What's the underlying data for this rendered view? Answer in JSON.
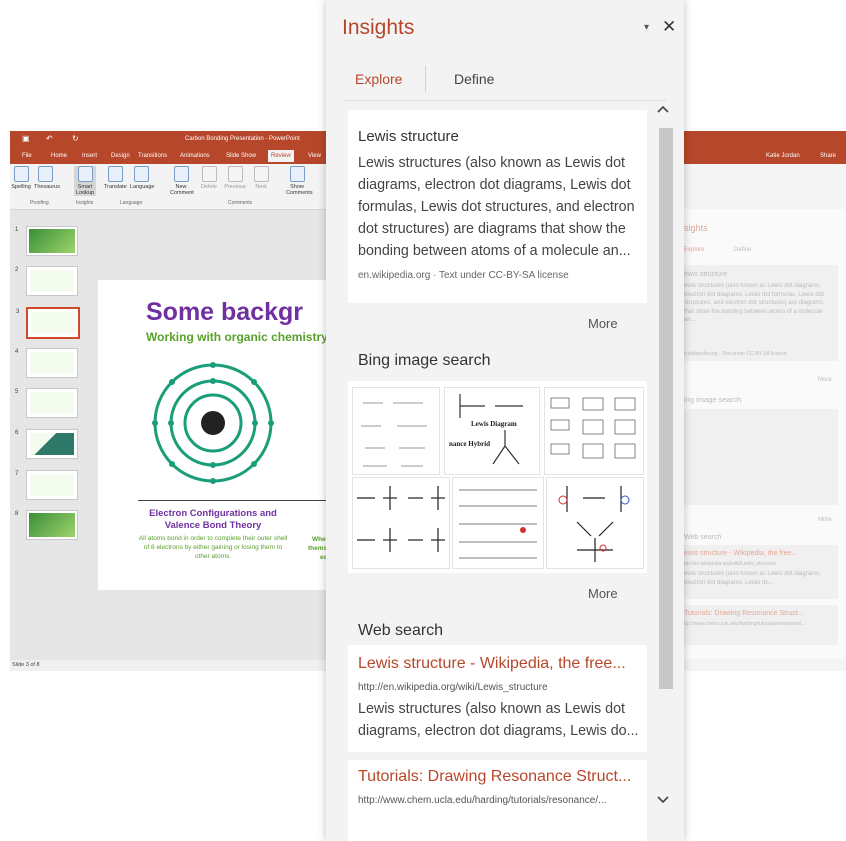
{
  "powerpoint": {
    "title": "Carbon Bonding Presentation - PowerPoint",
    "user": "Katie Jordan",
    "share_label": "Share",
    "tabs": [
      "File",
      "Home",
      "Insert",
      "Design",
      "Transitions",
      "Animations",
      "Slide Show",
      "Review",
      "View"
    ],
    "active_tab": "Review",
    "ribbon": {
      "spelling": "Spelling",
      "thesaurus": "Thesaurus",
      "smart_lookup": "Smart Lookup",
      "translate": "Translate",
      "language": "Language",
      "new_comment": "New Comment",
      "delete": "Delete",
      "previous": "Previous",
      "next": "Next",
      "show_comments": "Show Comments",
      "groups": [
        "Proofing",
        "Insights",
        "Language",
        "Comments"
      ]
    },
    "thumbnails": [
      "1",
      "2",
      "3",
      "4",
      "5",
      "6",
      "7",
      "8"
    ],
    "slide": {
      "heading": "Some backgr",
      "subheading": "Working with organic chemistry",
      "caption_title": "Electron Configurations and Valence Bond Theory",
      "caption_text": "All atoms bond in order to complete their outer shell of 8 electrons by either gaining or losing them to other atoms.",
      "caption_right_1": "When",
      "caption_right_2": "themselv",
      "caption_right_3": "ea"
    },
    "status": "Slide 3 of 8"
  },
  "ghost": {
    "title": "sights",
    "explore": "Explore",
    "define": "Define",
    "card_title": "ewis structure",
    "card_text": "ewis structures (also known as Lewis dot diagrams, electron dot diagrams, Lewis dot formulas, Lewis dot structures, and electron dot structures) are diagrams that show the bonding between atoms of a molecule an...",
    "card_src": "n.wikipedia.org · Text under CC-BY-SA license",
    "more": "More",
    "bing": "ing image search",
    "web": "Web search",
    "web1": "ewis structure - Wikipedia, the free...",
    "web1_url": "ttp://en.wikipedia.org/wiki/Lewis_structure",
    "web1_snip": "ewis structures (also known as Lewis dot diagrams, electron dot diagrams, Lewis do...",
    "web2": "Tutorials: Drawing Resonance Struct...",
    "web2_url": "ttp://www.chem.ucla.edu/harding/tutorials/resonance/..."
  },
  "insights": {
    "title": "Insights",
    "tabs": {
      "explore": "Explore",
      "define": "Define"
    },
    "wiki": {
      "title": "Lewis structure",
      "body": "Lewis structures (also known as Lewis dot diagrams, electron dot diagrams, Lewis dot formulas, Lewis dot structures, and electron dot structures) are diagrams that show the bonding between atoms of a molecule an...",
      "source": "en.wikipedia.org · Text under CC-BY-SA license"
    },
    "more_label": "More",
    "bing_title": "Bing image search",
    "image_labels": {
      "lewis_diagram": "Lewis Diagram",
      "hybrid": "nance Hybrid"
    },
    "web_title": "Web search",
    "results": [
      {
        "title": "Lewis structure - Wikipedia, the free...",
        "url": "http://en.wikipedia.org/wiki/Lewis_structure",
        "snippet": "Lewis structures (also known as Lewis dot diagrams, electron dot diagrams, Lewis do..."
      },
      {
        "title": "Tutorials: Drawing Resonance Struct...",
        "url": "http://www.chem.ucla.edu/harding/tutorials/resonance/..."
      }
    ],
    "icons": {
      "dropdown": "▾",
      "close": "✕",
      "scroll_up": "chevron-up-icon",
      "scroll_down": "chevron-down-icon"
    },
    "colors": {
      "accent": "#b7472a"
    }
  }
}
